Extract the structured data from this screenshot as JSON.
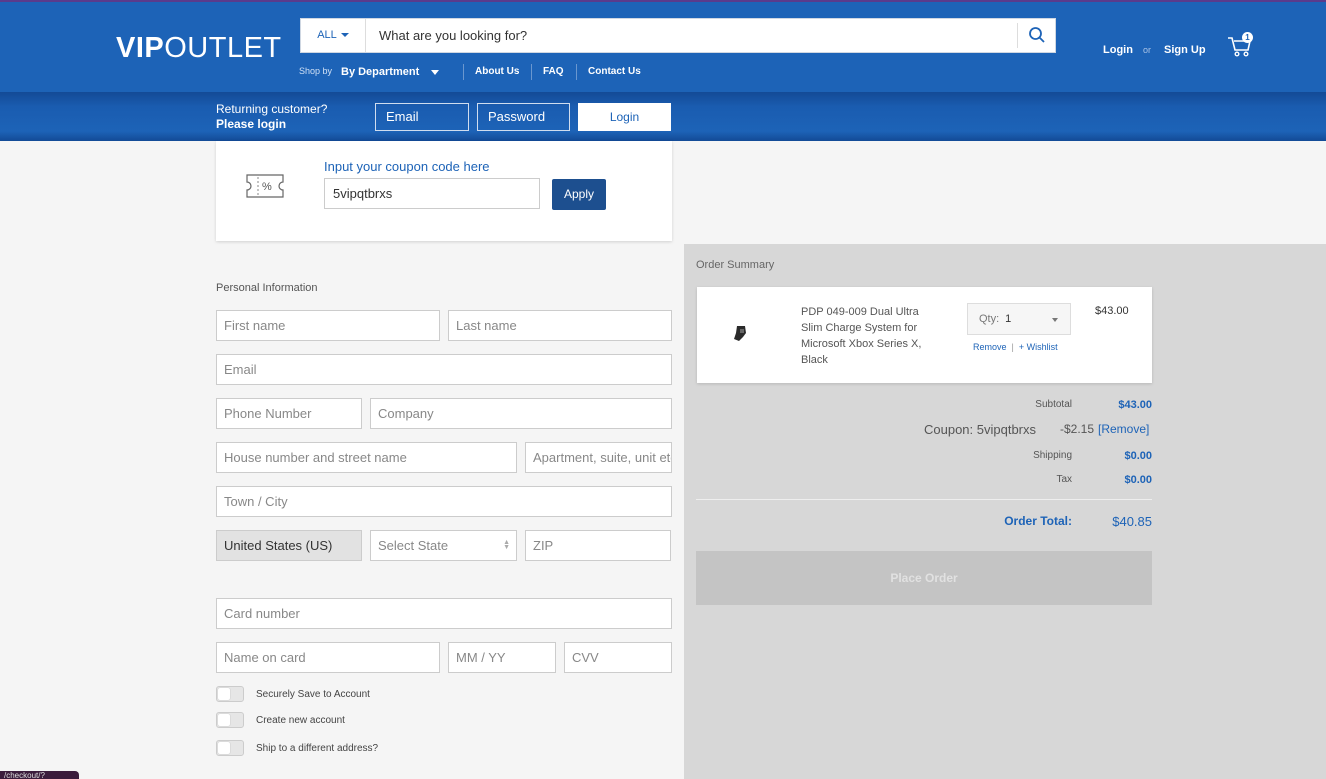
{
  "header": {
    "logo_bold": "VIP",
    "logo_light": "OUTLET",
    "search": {
      "category": "ALL",
      "placeholder": "What are you looking for?"
    },
    "shop_by": "Shop by",
    "department": "By Department",
    "nav": [
      "About Us",
      "FAQ",
      "Contact Us"
    ],
    "login": "Login",
    "or": "or",
    "signup": "Sign Up",
    "cart_count": "1"
  },
  "login_bar": {
    "line1": "Returning customer?",
    "line2": "Please login",
    "email": "Email",
    "password": "Password",
    "button": "Login"
  },
  "coupon": {
    "label": "Input your coupon code here",
    "value": "5vipqtbrxs",
    "apply": "Apply"
  },
  "personal_info": {
    "title": "Personal Information",
    "first_name": "First name",
    "last_name": "Last name",
    "email": "Email",
    "phone": "Phone Number",
    "company": "Company",
    "street": "House number and street name",
    "apartment": "Apartment, suite, unit etc.",
    "city": "Town / City",
    "country": "United States (US)",
    "state": "Select State",
    "zip": "ZIP"
  },
  "payment": {
    "card_number": "Card number",
    "name_on_card": "Name on card",
    "expiry": "MM / YY",
    "cvv": "CVV"
  },
  "options": [
    "Securely Save to Account",
    "Create new account",
    "Ship to a different address?"
  ],
  "summary": {
    "title": "Order Summary",
    "item": {
      "name": "PDP 049-009 Dual Ultra Slim Charge System for Microsoft Xbox Series X, Black",
      "qty_label": "Qty:",
      "qty": "1",
      "remove": "Remove",
      "wishlist": "+ Wishlist",
      "price": "$43.00"
    },
    "subtotal_label": "Subtotal",
    "subtotal": "$43.00",
    "coupon_label": "Coupon: 5vipqtbrxs",
    "coupon_amount": "-$2.15",
    "coupon_remove": "[Remove]",
    "shipping_label": "Shipping",
    "shipping": "$0.00",
    "tax_label": "Tax",
    "tax": "$0.00",
    "total_label": "Order Total:",
    "total": "$40.85",
    "place_order": "Place Order"
  },
  "debug_tab": "/checkout/?"
}
